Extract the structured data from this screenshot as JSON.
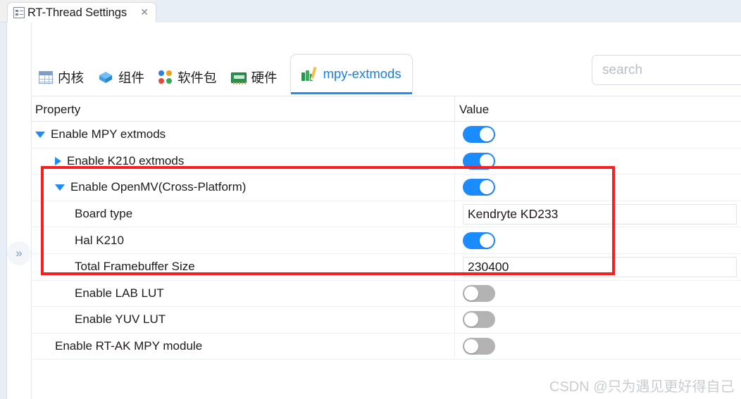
{
  "window": {
    "tab_title": "RT-Thread Settings",
    "tab_icon": "properties-icon",
    "close_label": "✕"
  },
  "rail": {
    "expand_label": "»"
  },
  "toolbar": {
    "tabs": [
      {
        "label": "内核",
        "icon": "grid-icon",
        "active": false
      },
      {
        "label": "组件",
        "icon": "cube-icon",
        "active": false
      },
      {
        "label": "软件包",
        "icon": "dots-icon",
        "active": false
      },
      {
        "label": "硬件",
        "icon": "board-icon",
        "active": false
      },
      {
        "label": "mpy-extmods",
        "icon": "books-icon",
        "active": true
      }
    ]
  },
  "search": {
    "value": "",
    "placeholder": "search"
  },
  "table": {
    "headers": {
      "property": "Property",
      "value": "Value"
    },
    "rows": [
      {
        "label": "Enable MPY extmods",
        "indent": 0,
        "arrow": "down",
        "value_type": "toggle",
        "value": "on"
      },
      {
        "label": "Enable K210 extmods",
        "indent": 1,
        "arrow": "right",
        "value_type": "toggle",
        "value": "on"
      },
      {
        "label": "Enable OpenMV(Cross-Platform)",
        "indent": 1,
        "arrow": "down",
        "value_type": "toggle",
        "value": "on"
      },
      {
        "label": "Board type",
        "indent": 2,
        "arrow": "none",
        "value_type": "input",
        "value": "Kendryte KD233"
      },
      {
        "label": "Hal K210",
        "indent": 2,
        "arrow": "none",
        "value_type": "toggle",
        "value": "on"
      },
      {
        "label": "Total Framebuffer Size",
        "indent": 2,
        "arrow": "none",
        "value_type": "input",
        "value": "230400"
      },
      {
        "label": "Enable LAB LUT",
        "indent": 2,
        "arrow": "none",
        "value_type": "toggle",
        "value": "off"
      },
      {
        "label": "Enable YUV LUT",
        "indent": 2,
        "arrow": "none",
        "value_type": "toggle",
        "value": "off"
      },
      {
        "label": "Enable RT-AK MPY module",
        "indent": 1,
        "arrow": "none",
        "value_type": "toggle",
        "value": "off"
      }
    ]
  },
  "annotation": {
    "color": "#f5201f"
  },
  "watermark": {
    "text": "CSDN @只为遇见更好得自己"
  },
  "colors": {
    "accent": "#1a8cff",
    "toggle_off": "#b3b3b3",
    "tab_active_text": "#1a7fe0"
  }
}
